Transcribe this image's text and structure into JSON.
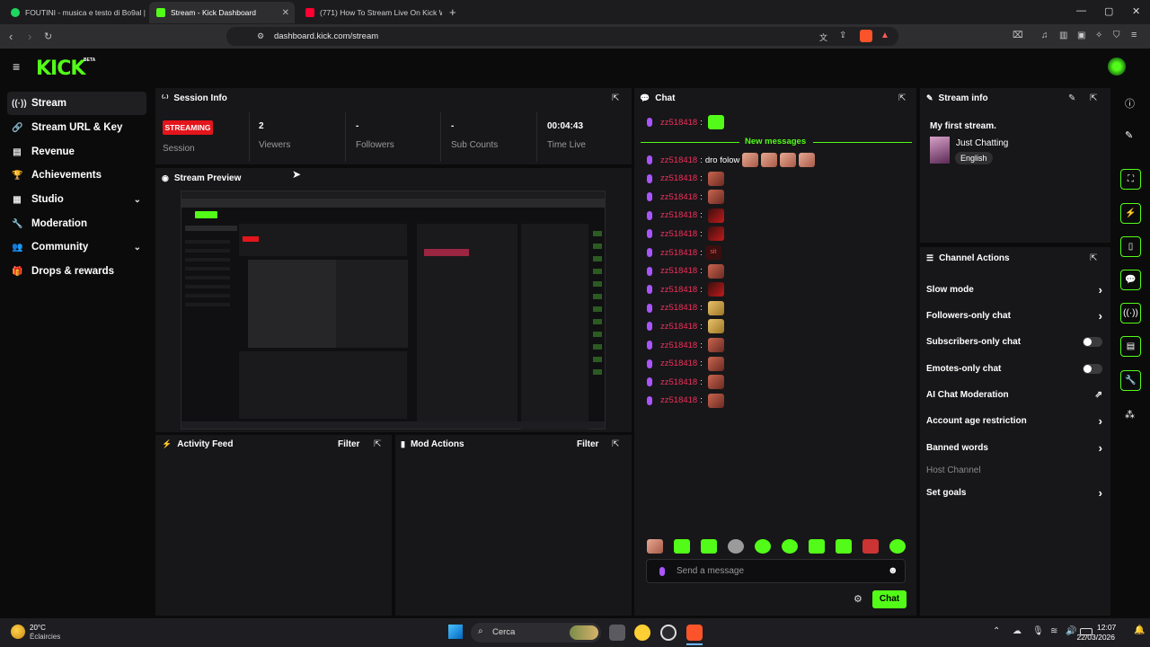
{
  "browser": {
    "tabs": [
      {
        "title": "FOUTINI - musica e testo di Bo9al | S"
      },
      {
        "title": "Stream - Kick Dashboard"
      },
      {
        "title": "(771) How To Stream Live On Kick W"
      }
    ],
    "url": "dashboard.kick.com/stream"
  },
  "app": {
    "logo": "KICK",
    "beta": "BETA"
  },
  "sidebar": {
    "items": [
      {
        "label": "Stream",
        "icon": "broadcast-icon"
      },
      {
        "label": "Stream URL & Key",
        "icon": "link-icon"
      },
      {
        "label": "Revenue",
        "icon": "revenue-icon"
      },
      {
        "label": "Achievements",
        "icon": "trophy-icon"
      },
      {
        "label": "Studio",
        "icon": "grid-icon"
      },
      {
        "label": "Moderation",
        "icon": "wrench-icon"
      },
      {
        "label": "Community",
        "icon": "people-icon"
      },
      {
        "label": "Drops & rewards",
        "icon": "gift-icon"
      }
    ]
  },
  "session": {
    "title": "Session Info",
    "badge": "STREAMING",
    "session_label": "Session",
    "viewers": {
      "value": "2",
      "label": "Viewers"
    },
    "followers": {
      "value": "-",
      "label": "Followers"
    },
    "subs": {
      "value": "-",
      "label": "Sub Counts"
    },
    "time": {
      "value": "00:04:43",
      "label": "Time Live"
    }
  },
  "preview": {
    "title": "Stream Preview"
  },
  "activity": {
    "title": "Activity Feed",
    "filter": "Filter"
  },
  "mod": {
    "title": "Mod Actions",
    "filter": "Filter"
  },
  "chat": {
    "title": "Chat",
    "new_messages": "New messages",
    "username": "zz518418",
    "first_line_text": "",
    "messages": [
      {
        "text": "dro folow"
      },
      {
        "text": ""
      },
      {
        "text": ""
      },
      {
        "text": ""
      },
      {
        "text": ""
      },
      {
        "text": "sit"
      },
      {
        "text": ""
      },
      {
        "text": ""
      },
      {
        "text": ""
      },
      {
        "text": ""
      },
      {
        "text": ""
      },
      {
        "text": ""
      },
      {
        "text": ""
      },
      {
        "text": ""
      }
    ],
    "input_placeholder": "Send a message",
    "send_label": "Chat"
  },
  "stream_info": {
    "title": "Stream info",
    "stream_title": "My first stream.",
    "category": "Just Chatting",
    "language": "English"
  },
  "channel_actions": {
    "title": "Channel Actions",
    "rows": [
      {
        "label": "Slow mode"
      },
      {
        "label": "Followers-only chat"
      },
      {
        "label": "Subscribers-only chat"
      },
      {
        "label": "Emotes-only chat"
      },
      {
        "label": "AI Chat Moderation"
      },
      {
        "label": "Account age restriction"
      },
      {
        "label": "Banned words"
      },
      {
        "label": "Host Channel"
      },
      {
        "label": "Set goals"
      }
    ]
  },
  "taskbar": {
    "weather_temp": "20°C",
    "weather_desc": "Éclaircies",
    "search": "Cerca",
    "time": "12:07",
    "date": "22/03/2026"
  }
}
